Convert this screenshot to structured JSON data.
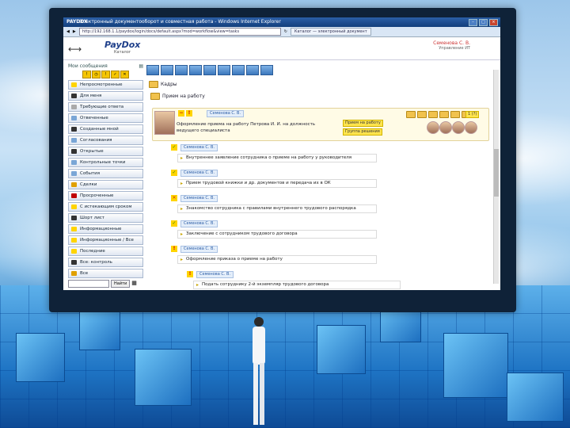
{
  "window": {
    "app_label": "PAYDOX",
    "title": "Электронный документооборот и совместная работа - Windows Internet Explorer"
  },
  "browser": {
    "address": "http://192.168.1.1/paydox/login/docs/default.aspx?mod=workflow&view=tasks",
    "tab": "Каталог — электронный документ"
  },
  "header": {
    "brand": "PayDox",
    "brand_sub": "Каталог",
    "user_name": "Семенова С. В.",
    "user_role": "Управление ИТ"
  },
  "sidebar": {
    "title": "Мои сообщения",
    "search_button": "Найти",
    "items": [
      {
        "label": "Непросмотренные",
        "color": "#ffd400"
      },
      {
        "label": "Для меня",
        "color": "#333333"
      },
      {
        "label": "Требующие ответа",
        "color": "#aaaaaa"
      },
      {
        "label": "Отвеченные",
        "color": "#7aa6d6"
      },
      {
        "label": "Созданные мной",
        "color": "#333333"
      },
      {
        "label": "Согласования",
        "color": "#7aa6d6"
      },
      {
        "label": "Открытые",
        "color": "#333333"
      },
      {
        "label": "Контрольные точки",
        "color": "#7aa6d6"
      },
      {
        "label": "События",
        "color": "#7aa6d6"
      },
      {
        "label": "Сделки",
        "color": "#e0a000"
      },
      {
        "label": "Просроченные",
        "color": "#c00000"
      },
      {
        "label": "С истекающим сроком",
        "color": "#ffd400"
      },
      {
        "label": "Шорт лист",
        "color": "#333333"
      },
      {
        "label": "Информационные",
        "color": "#ffd400"
      },
      {
        "label": "Информационные / Все",
        "color": "#ffd400"
      },
      {
        "label": "Последние",
        "color": "#ffd400"
      },
      {
        "label": "Все: контроль",
        "color": "#333333"
      },
      {
        "label": "Все",
        "color": "#e0a000"
      }
    ]
  },
  "folders": [
    {
      "label": "Кадры"
    },
    {
      "label": "Прием на работу"
    }
  ],
  "process": {
    "author": "Семенова С. В.",
    "title": "Оформление приема на работу Петрова И. И. на должность ведущего специалиста",
    "badge_1": "Прием на работу",
    "badge_2": "Группа решения",
    "badge_count": "1 (?)"
  },
  "tasks": [
    {
      "assignee": "Семенова С. В.",
      "status": "done",
      "text": "Внутреннее заявление сотрудника о приеме на работу у руководителя"
    },
    {
      "assignee": "Семенова С. В.",
      "status": "done",
      "text": "Прием трудовой книжки и др. документов и передача их в ОК"
    },
    {
      "assignee": "Семенова С. В.",
      "status": "rejected",
      "text": "Знакомство сотрудника с правилами внутреннего трудового распорядка"
    },
    {
      "assignee": "Семенова С. В.",
      "status": "done",
      "text": "Заключение с сотрудником трудового договора"
    },
    {
      "assignee": "Семенова С. В.",
      "status": "pending",
      "text": "Оформление приказа о приеме на работу"
    },
    {
      "assignee": "Семенова С. В.",
      "status": "pending",
      "text": "Подать сотруднику 2-й экземпляр трудового договора"
    }
  ]
}
